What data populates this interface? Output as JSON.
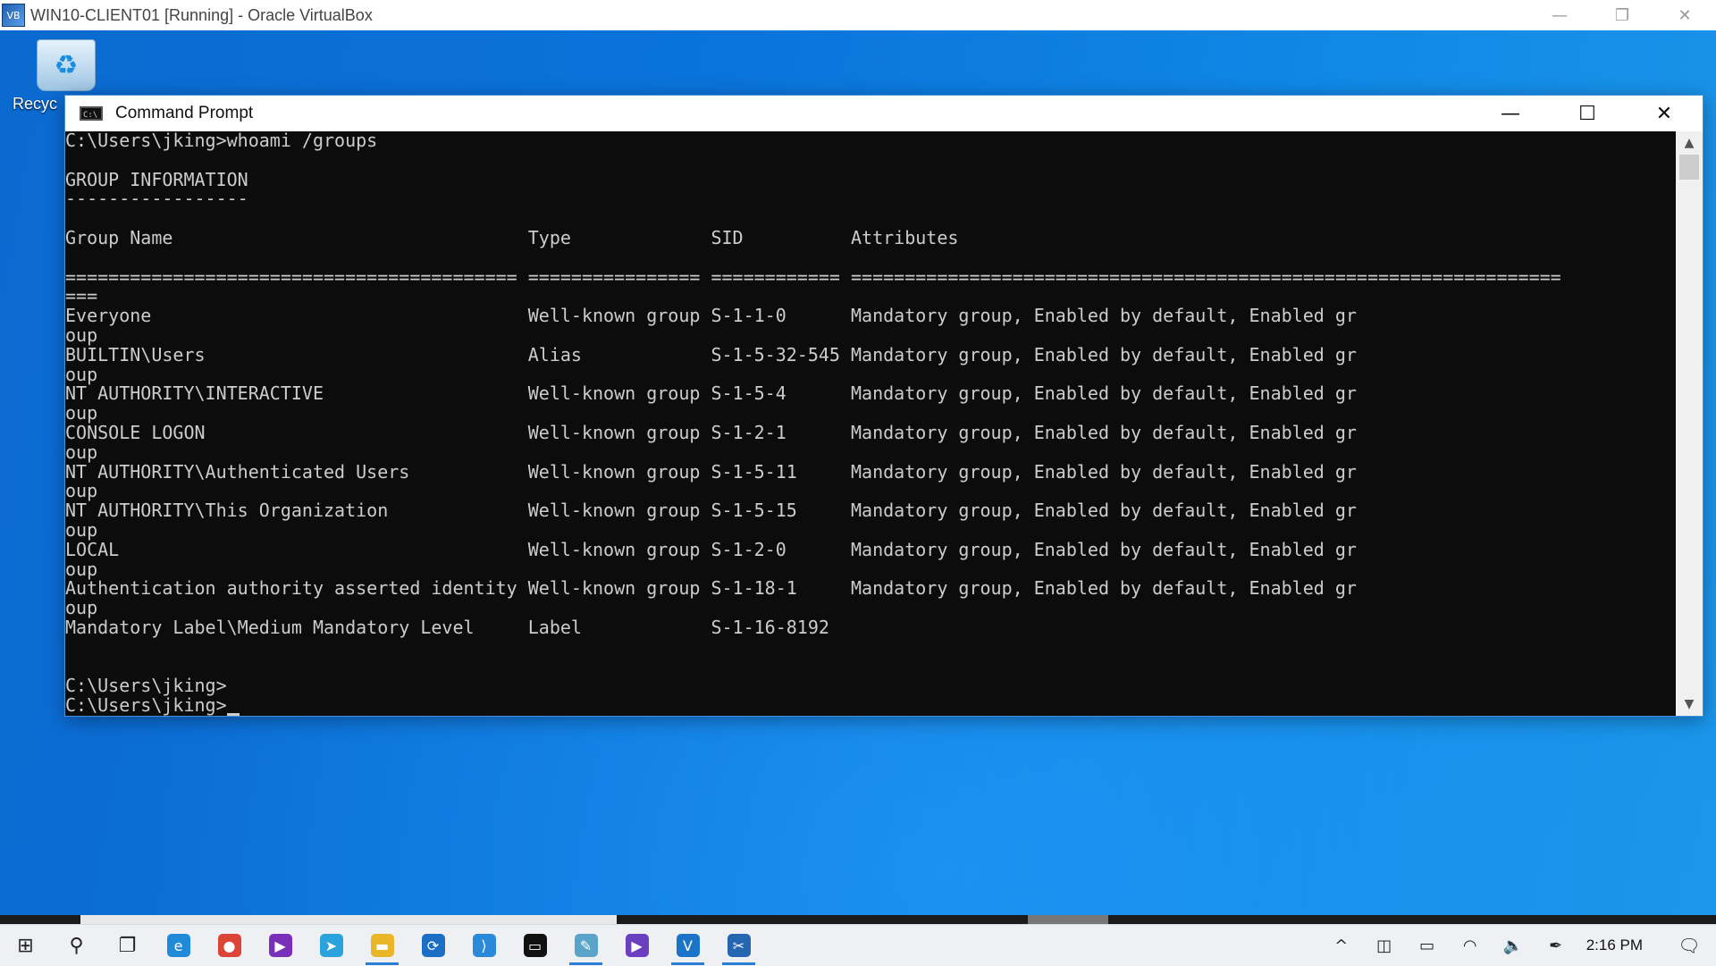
{
  "host_window": {
    "title": "WIN10-CLIENT01 [Running] - Oracle VirtualBox",
    "icon": "virtualbox-icon",
    "controls": [
      "minimize",
      "restore",
      "close"
    ]
  },
  "desktop": {
    "recycle_bin_label": "Recyc"
  },
  "cmd_window": {
    "title": "Command Prompt",
    "console_lines": [
      "C:\\Users\\jking>whoami /groups",
      "",
      "GROUP INFORMATION",
      "-----------------",
      "",
      "Group Name                                 Type             SID          Attributes",
      "",
      "========================================== ================ ============ ==================================================================",
      "===",
      "Everyone                                   Well-known group S-1-1-0      Mandatory group, Enabled by default, Enabled gr",
      "oup",
      "BUILTIN\\Users                              Alias            S-1-5-32-545 Mandatory group, Enabled by default, Enabled gr",
      "oup",
      "NT AUTHORITY\\INTERACTIVE                   Well-known group S-1-5-4      Mandatory group, Enabled by default, Enabled gr",
      "oup",
      "CONSOLE LOGON                              Well-known group S-1-2-1      Mandatory group, Enabled by default, Enabled gr",
      "oup",
      "NT AUTHORITY\\Authenticated Users           Well-known group S-1-5-11     Mandatory group, Enabled by default, Enabled gr",
      "oup",
      "NT AUTHORITY\\This Organization             Well-known group S-1-5-15     Mandatory group, Enabled by default, Enabled gr",
      "oup",
      "LOCAL                                      Well-known group S-1-2-0      Mandatory group, Enabled by default, Enabled gr",
      "oup",
      "Authentication authority asserted identity Well-known group S-1-18-1     Mandatory group, Enabled by default, Enabled gr",
      "oup",
      "Mandatory Label\\Medium Mandatory Level     Label            S-1-16-8192",
      "",
      "",
      "C:\\Users\\jking>"
    ],
    "prompt_line": "C:\\Users\\jking>"
  },
  "taskbar": {
    "apps": [
      {
        "name": "start-button",
        "icon": "windows-icon",
        "glyph": "⊞",
        "color": "#222222"
      },
      {
        "name": "search-button",
        "icon": "search-icon",
        "glyph": "⚲",
        "color": "#222222"
      },
      {
        "name": "task-view-button",
        "icon": "task-view-icon",
        "glyph": "❐",
        "color": "#222222"
      },
      {
        "name": "taskbar-edge",
        "icon": "edge-icon",
        "glyph": "e",
        "color": "#1f8bd8"
      },
      {
        "name": "taskbar-chrome",
        "icon": "chrome-icon",
        "glyph": "●",
        "color": "#db4437"
      },
      {
        "name": "taskbar-app-purple",
        "icon": "media-icon",
        "glyph": "▶",
        "color": "#7a2fb8"
      },
      {
        "name": "taskbar-telegram",
        "icon": "telegram-icon",
        "glyph": "➤",
        "color": "#2aa3dd"
      },
      {
        "name": "taskbar-file-explorer",
        "icon": "folder-icon",
        "glyph": "▬",
        "color": "#e8b628"
      },
      {
        "name": "taskbar-app-sync",
        "icon": "sync-icon",
        "glyph": "⟳",
        "color": "#1a6fc4"
      },
      {
        "name": "taskbar-vscode",
        "icon": "vscode-icon",
        "glyph": "⟩",
        "color": "#2a8ad9"
      },
      {
        "name": "taskbar-terminal",
        "icon": "terminal-icon",
        "glyph": "▭",
        "color": "#111111"
      },
      {
        "name": "taskbar-app-notepad",
        "icon": "notepad-icon",
        "glyph": "✎",
        "color": "#5aa3c9"
      },
      {
        "name": "taskbar-app-visualstudio",
        "icon": "visual-studio-icon",
        "glyph": "▶",
        "color": "#6a3fc0"
      },
      {
        "name": "taskbar-app-vs",
        "icon": "vs-installer-icon",
        "glyph": "V",
        "color": "#1b74c8"
      },
      {
        "name": "taskbar-app-video",
        "icon": "video-editor-icon",
        "glyph": "✂",
        "color": "#2566b0"
      }
    ],
    "active_apps": [
      "taskbar-file-explorer",
      "taskbar-app-notepad",
      "taskbar-app-vs",
      "taskbar-app-video"
    ],
    "tray": [
      {
        "name": "show-hidden-icons",
        "icon": "chevron-up-icon",
        "glyph": "^"
      },
      {
        "name": "meet-now",
        "icon": "camera-icon",
        "glyph": "◫"
      },
      {
        "name": "battery",
        "icon": "battery-icon",
        "glyph": "▭"
      },
      {
        "name": "network",
        "icon": "wifi-icon",
        "glyph": "◠"
      },
      {
        "name": "volume",
        "icon": "speaker-icon",
        "glyph": "🔈"
      },
      {
        "name": "pen-workspace",
        "icon": "pen-icon",
        "glyph": "✒"
      }
    ],
    "clock": "2:16 PM"
  }
}
